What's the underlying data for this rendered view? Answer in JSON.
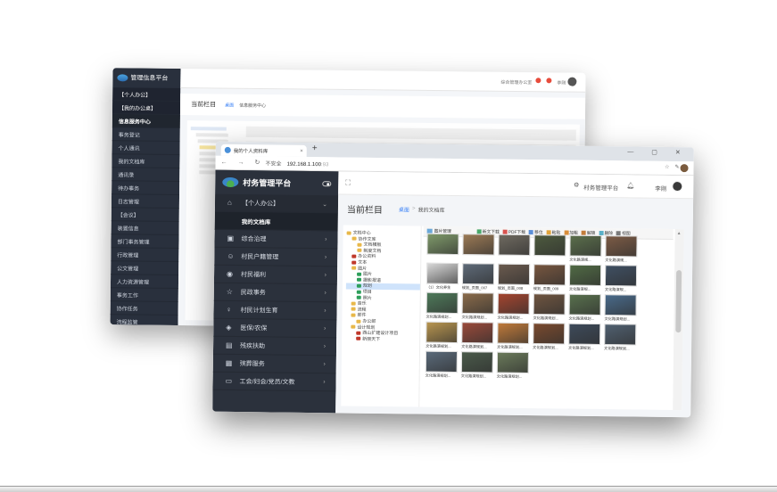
{
  "back": {
    "brand": "管理信息平台",
    "top_text": "综合管理办公室",
    "top_user": "李刚",
    "title": "当前栏目",
    "crumb_1": "桌面",
    "crumb_2": "信息服务中心",
    "menu": [
      "【个人办公】",
      "【我的办公桌】",
      "信息服务中心",
      "事务登记",
      "个人通讯",
      "我的文档库",
      "通讯录",
      "待办事务",
      "日志管理",
      "【会议】",
      "装置信息",
      "部门事务管理",
      "行政管理",
      "公文管理",
      "人力资源管理",
      "事务工作",
      "协作任务",
      "流程监管"
    ]
  },
  "front": {
    "tab_title": "我的个人资料库",
    "tab_close": "×",
    "new_tab": "+",
    "win_buttons": "— ▢ ✕",
    "nav": "← → ↻",
    "not_secure": "不安全",
    "url": "192.168.1.100",
    "url_dim": ":93",
    "brand": "村务管理平台",
    "manager_label": "村务管理平台",
    "user_name": "李刚",
    "page_title": "当前栏目",
    "crumb_home": "桌面",
    "crumb_sep": ">",
    "crumb_current": "我的文档库",
    "menu": [
      {
        "label": "【个人办公】",
        "icon": "⌂"
      },
      {
        "label": "我的文档库",
        "icon": ""
      },
      {
        "label": "综合治理",
        "icon": "▣"
      },
      {
        "label": "村民户籍管理",
        "icon": "☺"
      },
      {
        "label": "村民福利",
        "icon": "◉"
      },
      {
        "label": "民政事务",
        "icon": "☆"
      },
      {
        "label": "村民计划生育",
        "icon": "♀"
      },
      {
        "label": "医保/农保",
        "icon": "◈"
      },
      {
        "label": "残疾扶助",
        "icon": "▤"
      },
      {
        "label": "殡葬服务",
        "icon": "▦"
      },
      {
        "label": "工会/妇会/党员/文教",
        "icon": "▭"
      }
    ],
    "tree": [
      {
        "label": "文档中心",
        "indent": 0,
        "color": ""
      },
      {
        "label": "协作文库",
        "indent": 1,
        "color": ""
      },
      {
        "label": "文档模板",
        "indent": 2,
        "color": ""
      },
      {
        "label": "制度文档",
        "indent": 2,
        "color": ""
      },
      {
        "label": "办公资料",
        "indent": 1,
        "color": "red"
      },
      {
        "label": "文本",
        "indent": 1,
        "color": "red"
      },
      {
        "label": "图片",
        "indent": 1,
        "color": ""
      },
      {
        "label": "图片",
        "indent": 2,
        "color": "grn"
      },
      {
        "label": "摄影报道",
        "indent": 2,
        "color": "grn"
      },
      {
        "label": "规划",
        "indent": 2,
        "color": "grn"
      },
      {
        "label": "项目",
        "indent": 2,
        "color": "grn"
      },
      {
        "label": "照片",
        "indent": 2,
        "color": "grn"
      },
      {
        "label": "音乐",
        "indent": 1,
        "color": ""
      },
      {
        "label": "流程",
        "indent": 1,
        "color": ""
      },
      {
        "label": "邮件",
        "indent": 1,
        "color": ""
      },
      {
        "label": "办公邮",
        "indent": 2,
        "color": ""
      },
      {
        "label": "设计规划",
        "indent": 1,
        "color": ""
      },
      {
        "label": "西山扩建设计项目",
        "indent": 2,
        "color": "red"
      },
      {
        "label": "新丽天下",
        "indent": 2,
        "color": "red"
      }
    ],
    "grid_header": "图片管理",
    "toolbar": [
      "新文下载",
      "PDF下载",
      "移位",
      "粘贴",
      "加粗",
      "解锁",
      "删除",
      "视图"
    ],
    "tiles": [
      {
        "label": "",
        "color": "#7f9a6a"
      },
      {
        "label": "",
        "color": "#9c7a55"
      },
      {
        "label": "",
        "color": "#6f6a60"
      },
      {
        "label": "",
        "color": "#4d5a3e"
      },
      {
        "label": "文化路演规...",
        "color": "#5a6e4b"
      },
      {
        "label": "文化路演规...",
        "color": "#7c5b45"
      },
      {
        "label": "（1）文化养生",
        "color": "#d8d8d8"
      },
      {
        "label": "规划_页面_007",
        "color": "#5e6a78"
      },
      {
        "label": "规划_页面_008",
        "color": "#6a5a4e"
      },
      {
        "label": "规划_页面_009",
        "color": "#77563f"
      },
      {
        "label": "文化路演规...",
        "color": "#506a44"
      },
      {
        "label": "文化路演规...",
        "color": "#3f4f62"
      },
      {
        "label": "文化路演规划...",
        "color": "#4e7a5a"
      },
      {
        "label": "文化路演规划...",
        "color": "#8a6b4a"
      },
      {
        "label": "文化路演规划...",
        "color": "#a5452f"
      },
      {
        "label": "文化路演规划...",
        "color": "#6f5540"
      },
      {
        "label": "文化路演规划...",
        "color": "#58704d"
      },
      {
        "label": "文化路演规划...",
        "color": "#496a8a"
      },
      {
        "label": "文化路演规划...",
        "color": "#b8954f"
      },
      {
        "label": "文化路演规划...",
        "color": "#9a4a3a"
      },
      {
        "label": "文化路演规划...",
        "color": "#c07a3a"
      },
      {
        "label": "文化路演规划...",
        "color": "#7a4a2e"
      },
      {
        "label": "文化路演规划...",
        "color": "#3d4a5a"
      },
      {
        "label": "文化路演规划...",
        "color": "#506070"
      },
      {
        "label": "文化路演规划...",
        "color": "#5a6a7a"
      },
      {
        "label": "文化路演规划...",
        "color": "#4a5a4a"
      },
      {
        "label": "文化路演规划...",
        "color": "#6a7a5a"
      }
    ]
  }
}
